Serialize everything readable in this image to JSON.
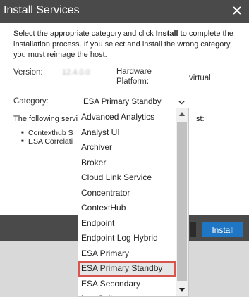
{
  "dialog": {
    "title": "Install Services",
    "instructions": {
      "part1": "Select the appropriate category and click ",
      "bold": "Install",
      "part2": " to complete the installation process. If you select and install the wrong category, you must reimage the host."
    },
    "version_label": "Version:",
    "version_value": "12.4.0.0",
    "hardware_label_line1": "Hardware",
    "hardware_label_line2": "Platform:",
    "hardware_value": "virtual",
    "category_label": "Category:",
    "category_selected": "ESA Primary Standby",
    "services_text": "The following servi",
    "services_tail": "st:",
    "services": [
      "Contexthub S",
      "ESA Correlati"
    ],
    "install_label": "Install"
  },
  "dropdown": {
    "options": [
      "Advanced Analytics",
      "Analyst UI",
      "Archiver",
      "Broker",
      "Cloud Link Service",
      "Concentrator",
      "ContextHub",
      "Endpoint",
      "Endpoint Log Hybrid",
      "ESA Primary",
      "ESA Primary Standby",
      "ESA Secondary",
      "Log Collector"
    ],
    "selected_index": 10
  },
  "colors": {
    "titlebar": "#4a4a4a",
    "install_button": "#1f76c5",
    "selection_outline": "#d9534f"
  }
}
